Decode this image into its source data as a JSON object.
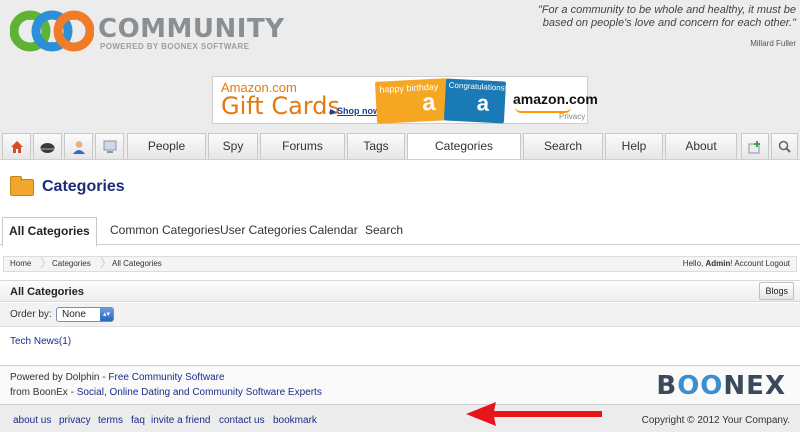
{
  "header": {
    "logo_title": "COMMUNITY",
    "logo_subtitle": "POWERED BY BOONEX SOFTWARE",
    "quote": "\"For a community to be whole and healthy, it must be based on people's love and concern for each other.\"",
    "quote_author": "Millard Fuller"
  },
  "ad": {
    "line1": "Amazon.com",
    "line2": "Gift Cards",
    "shop_now": "Shop now",
    "card1_text": "happy birthday",
    "card1_glyph": "a",
    "card2_text": "Congratulations!",
    "card2_glyph": "a",
    "brand": "amazon.com",
    "privacy": "Privacy"
  },
  "nav": {
    "icons": [
      "home-icon",
      "helmet-icon",
      "user-icon",
      "screen-icon"
    ],
    "tabs": [
      "People",
      "Spy",
      "Forums",
      "Tags",
      "Categories",
      "Search",
      "Help",
      "About"
    ],
    "active_tab": "Categories",
    "right_icons": [
      "add-icon",
      "search-icon"
    ]
  },
  "page": {
    "title": "Categories"
  },
  "subtabs": [
    "All Categories",
    "Common Categories",
    "User Categories",
    "Calendar",
    "Search"
  ],
  "breadcrumb": {
    "items": [
      "Home",
      "Categories",
      "All Categories"
    ],
    "hello": "Hello, ",
    "username": "Admin",
    "exclaim": "!",
    "account": "Account",
    "logout": "Logout"
  },
  "block": {
    "title": "All Categories",
    "blogs_button": "Blogs",
    "order_label": "Order by:",
    "order_value": "None",
    "items": [
      "Tech News(1)"
    ]
  },
  "footer": {
    "powered_prefix": "Powered by Dolphin - ",
    "powered_link": "Free Community Software",
    "from_prefix": "from BoonEx - ",
    "from_link": "Social, Online Dating and Community Software Experts",
    "logo": "BOONEX",
    "links": [
      "about us",
      "privacy",
      "terms",
      "faq",
      "invite a friend",
      "contact us",
      "bookmark"
    ],
    "copyright": "Copyright © 2012 Your Company."
  },
  "colors": {
    "annotation_arrow": "#e8141c",
    "link": "#1a2d8a",
    "title": "#1a2d7a",
    "logo_accent": "#3a8fd0"
  }
}
